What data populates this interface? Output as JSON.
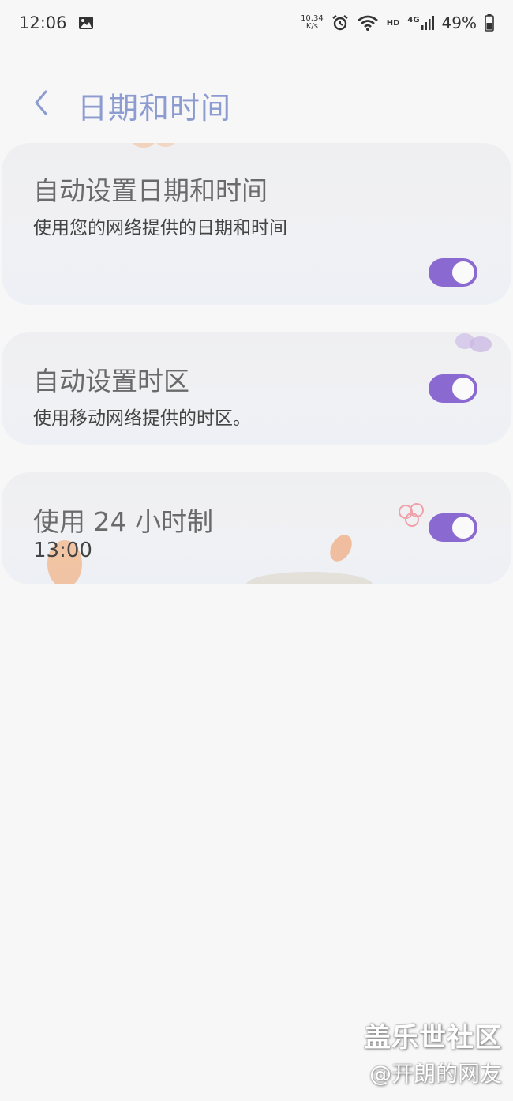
{
  "status_bar": {
    "time": "12:06",
    "net_speed_value": "10.34",
    "net_speed_unit": "K/s",
    "hd_label": "HD",
    "signal_label": "4G",
    "battery": "49%"
  },
  "header": {
    "title": "日期和时间"
  },
  "settings": [
    {
      "title": "自动设置日期和时间",
      "subtitle": "使用您的网络提供的日期和时间",
      "enabled": true
    },
    {
      "title": "自动设置时区",
      "subtitle": "使用移动网络提供的时区。",
      "enabled": true
    },
    {
      "title": "使用 24 小时制",
      "subtitle": "13:00",
      "enabled": true
    }
  ],
  "watermark": {
    "line1": "盖乐世社区",
    "line2": "@开朗的网友"
  },
  "colors": {
    "accent": "#8a6ad0",
    "title": "#8c9bd0",
    "background": "#f7f7f8"
  }
}
